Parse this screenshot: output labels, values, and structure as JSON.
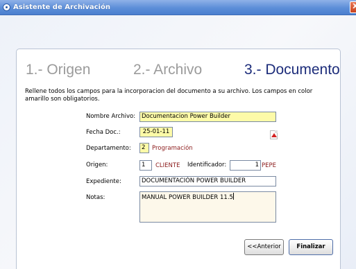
{
  "window": {
    "title": "Asistente de Archivación",
    "close_glyph": "X"
  },
  "steps": [
    {
      "label": "1.- Origen",
      "active": false
    },
    {
      "label": "2.- Archivo",
      "active": false
    },
    {
      "label": "3.- Documento",
      "active": true
    }
  ],
  "form": {
    "intro": "Rellene todos los campos para la incorporacion del documento a su archivo. Los campos en color amarillo son obligatorios.",
    "nombre_archivo": {
      "label": "Nombre Archivo:",
      "value": "Documentacion Power Builder"
    },
    "fecha_doc": {
      "label": "Fecha Doc.:",
      "value": "25-01-11"
    },
    "departamento": {
      "label": "Departamento:",
      "code": "2",
      "name": "Programación"
    },
    "origen": {
      "label": "Origen:",
      "code": "1",
      "name": "CLIENTE"
    },
    "identificador": {
      "label": "Identificador:",
      "code": "1",
      "name": "PEPE"
    },
    "expediente": {
      "label": "Expediente:",
      "value": "DOCUMENTACIÓN POWER BUILDER"
    },
    "notas": {
      "label": "Notas:",
      "value": "MANUAL POWER BUILDER 11.5"
    }
  },
  "buttons": {
    "back": "<<Anterior",
    "finish": "Finalizar"
  },
  "icons": {
    "title": "wizard-icon",
    "pdf": "pdf-icon"
  },
  "colors": {
    "required_field": "#fdfaa8",
    "active_step": "#1c2c7a",
    "inactive_step": "#9b9b9b",
    "lookup_text": "#8b1a1a"
  }
}
